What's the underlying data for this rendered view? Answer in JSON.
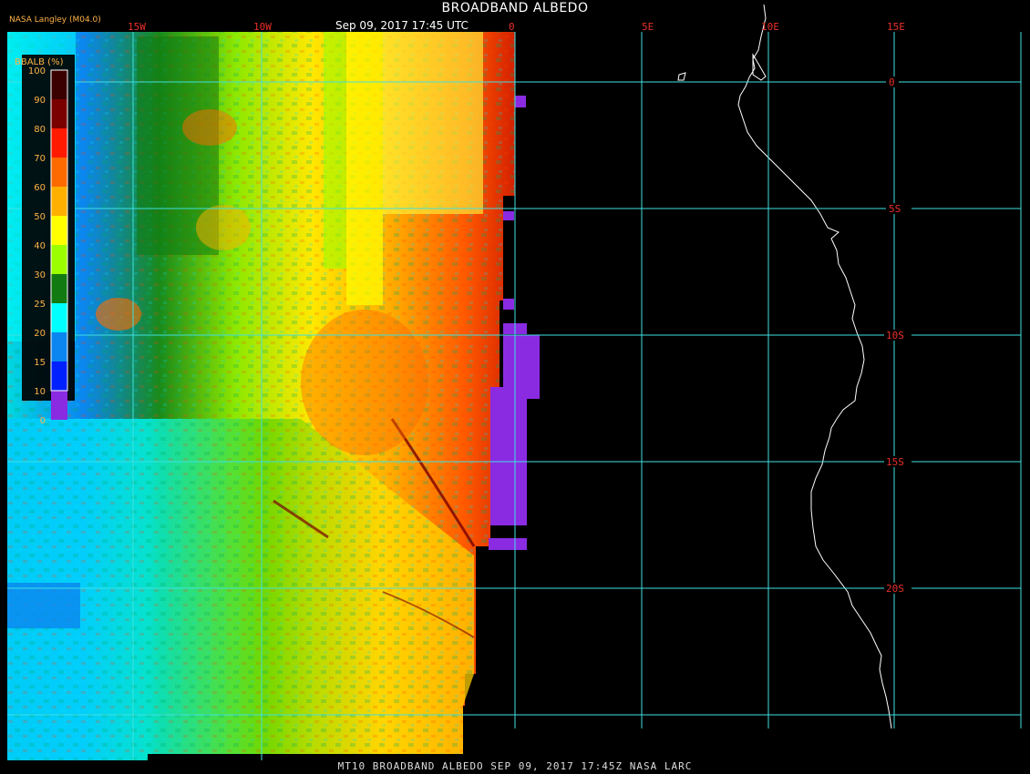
{
  "header": {
    "title": "BROADBAND ALBEDO",
    "datetime": "Sep 09, 2017 17:45 UTC",
    "provider": "NASA Langley (M04.0)"
  },
  "footer": {
    "caption": "MT10  BROADBAND ALBEDO   SEP 09, 2017 17:45Z   NASA LARC"
  },
  "longitude_labels": [
    "15W",
    "10W",
    "0",
    "5E",
    "10E",
    "15E"
  ],
  "latitude_labels": [
    "0",
    "5S",
    "10S",
    "15S",
    "20S"
  ],
  "colorbar": {
    "label": "BBALB (%)",
    "ticks": [
      "100",
      "90",
      "80",
      "70",
      "60",
      "50",
      "40",
      "30",
      "25",
      "20",
      "15",
      "10",
      "0"
    ],
    "colors": [
      "#3a0000",
      "#7a0000",
      "#ff1a00",
      "#ff6a00",
      "#ffb000",
      "#ffff00",
      "#9cff00",
      "#117a11",
      "#00ffff",
      "#0b86f0",
      "#0020ff",
      "#8a2be2"
    ]
  },
  "colors": {
    "grid": "#40e0e0",
    "label": "#e8302a",
    "coast": "#ffffff",
    "no_data": "#8a2be2"
  }
}
